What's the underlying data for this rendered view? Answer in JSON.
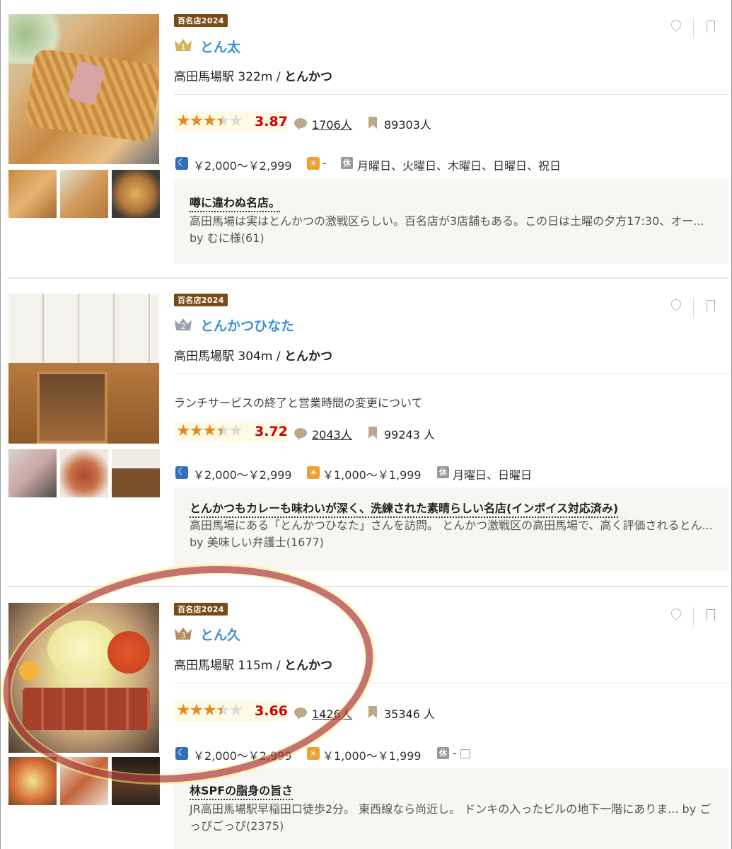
{
  "restaurants": [
    {
      "badge": "百名店2024",
      "rank": "1",
      "name": "とん太",
      "station_distance": "高田馬場駅 322m /",
      "genre": "とんかつ",
      "notice": "",
      "score": "3.87",
      "rating_fraction": 0.774,
      "reviews": "1706人",
      "saves": "89303人",
      "dinner_price": "￥2,000～￥2,999",
      "lunch_price": "-",
      "closed_days": "月曜日、火曜日、木曜日、日曜日、祝日",
      "review_title": "噂に違わぬ名店。",
      "review_text": "高田馬場は実はとんかつの激戦区らしい。百名店が3店舗もある。この日は土曜の夕方17:30、オー... by むに様(61)"
    },
    {
      "badge": "百名店2024",
      "rank": "2",
      "name": "とんかつひなた",
      "station_distance": "高田馬場駅 304m /",
      "genre": "とんかつ",
      "notice": "ランチサービスの終了と営業時間の変更について",
      "score": "3.72",
      "rating_fraction": 0.744,
      "reviews": "2043人",
      "saves": "99243 人",
      "dinner_price": "￥2,000～￥2,999",
      "lunch_price": "￥1,000～￥1,999",
      "closed_days": "月曜日、日曜日",
      "review_title": "とんかつもカレーも味わいが深く、洗練された素晴らしい名店(インボイス対応済み)",
      "review_text": "高田馬場にある「とんかつひなた」さんを訪問。 とんかつ激戦区の高田馬場で、高く評価されるとん... by 美味しい弁護士(1677)"
    },
    {
      "badge": "百名店2024",
      "rank": "3",
      "name": "とん久",
      "station_distance": "高田馬場駅 115m /",
      "genre": "とんかつ",
      "notice": "",
      "score": "3.66",
      "rating_fraction": 0.732,
      "reviews": "1426人",
      "saves": "35346 人",
      "dinner_price": "￥2,000～￥2,999",
      "lunch_price": "￥1,000～￥1,999",
      "closed_days": "-",
      "review_title": "林SPFの脂身の旨さ",
      "review_text": "JR高田馬場駅早稲田口徒歩2分。 東西線なら尚近し。 ドンキの入ったビルの地下一階にありま... by ごっぴごっぴ(2375)"
    }
  ],
  "icons": {
    "dinner": "moon-icon",
    "lunch": "sun-icon",
    "closed": "closed-day-icon",
    "reviews": "comment-icon",
    "saves": "bookmark-icon",
    "map": "map-pin-icon",
    "save": "save-bookmark-icon"
  },
  "colors": {
    "name_link": "#3a8fd8",
    "score": "#d00000",
    "stars": "#e58b1e",
    "badge": "#7a4b16",
    "annotation_circle": "#ae3c3c"
  }
}
